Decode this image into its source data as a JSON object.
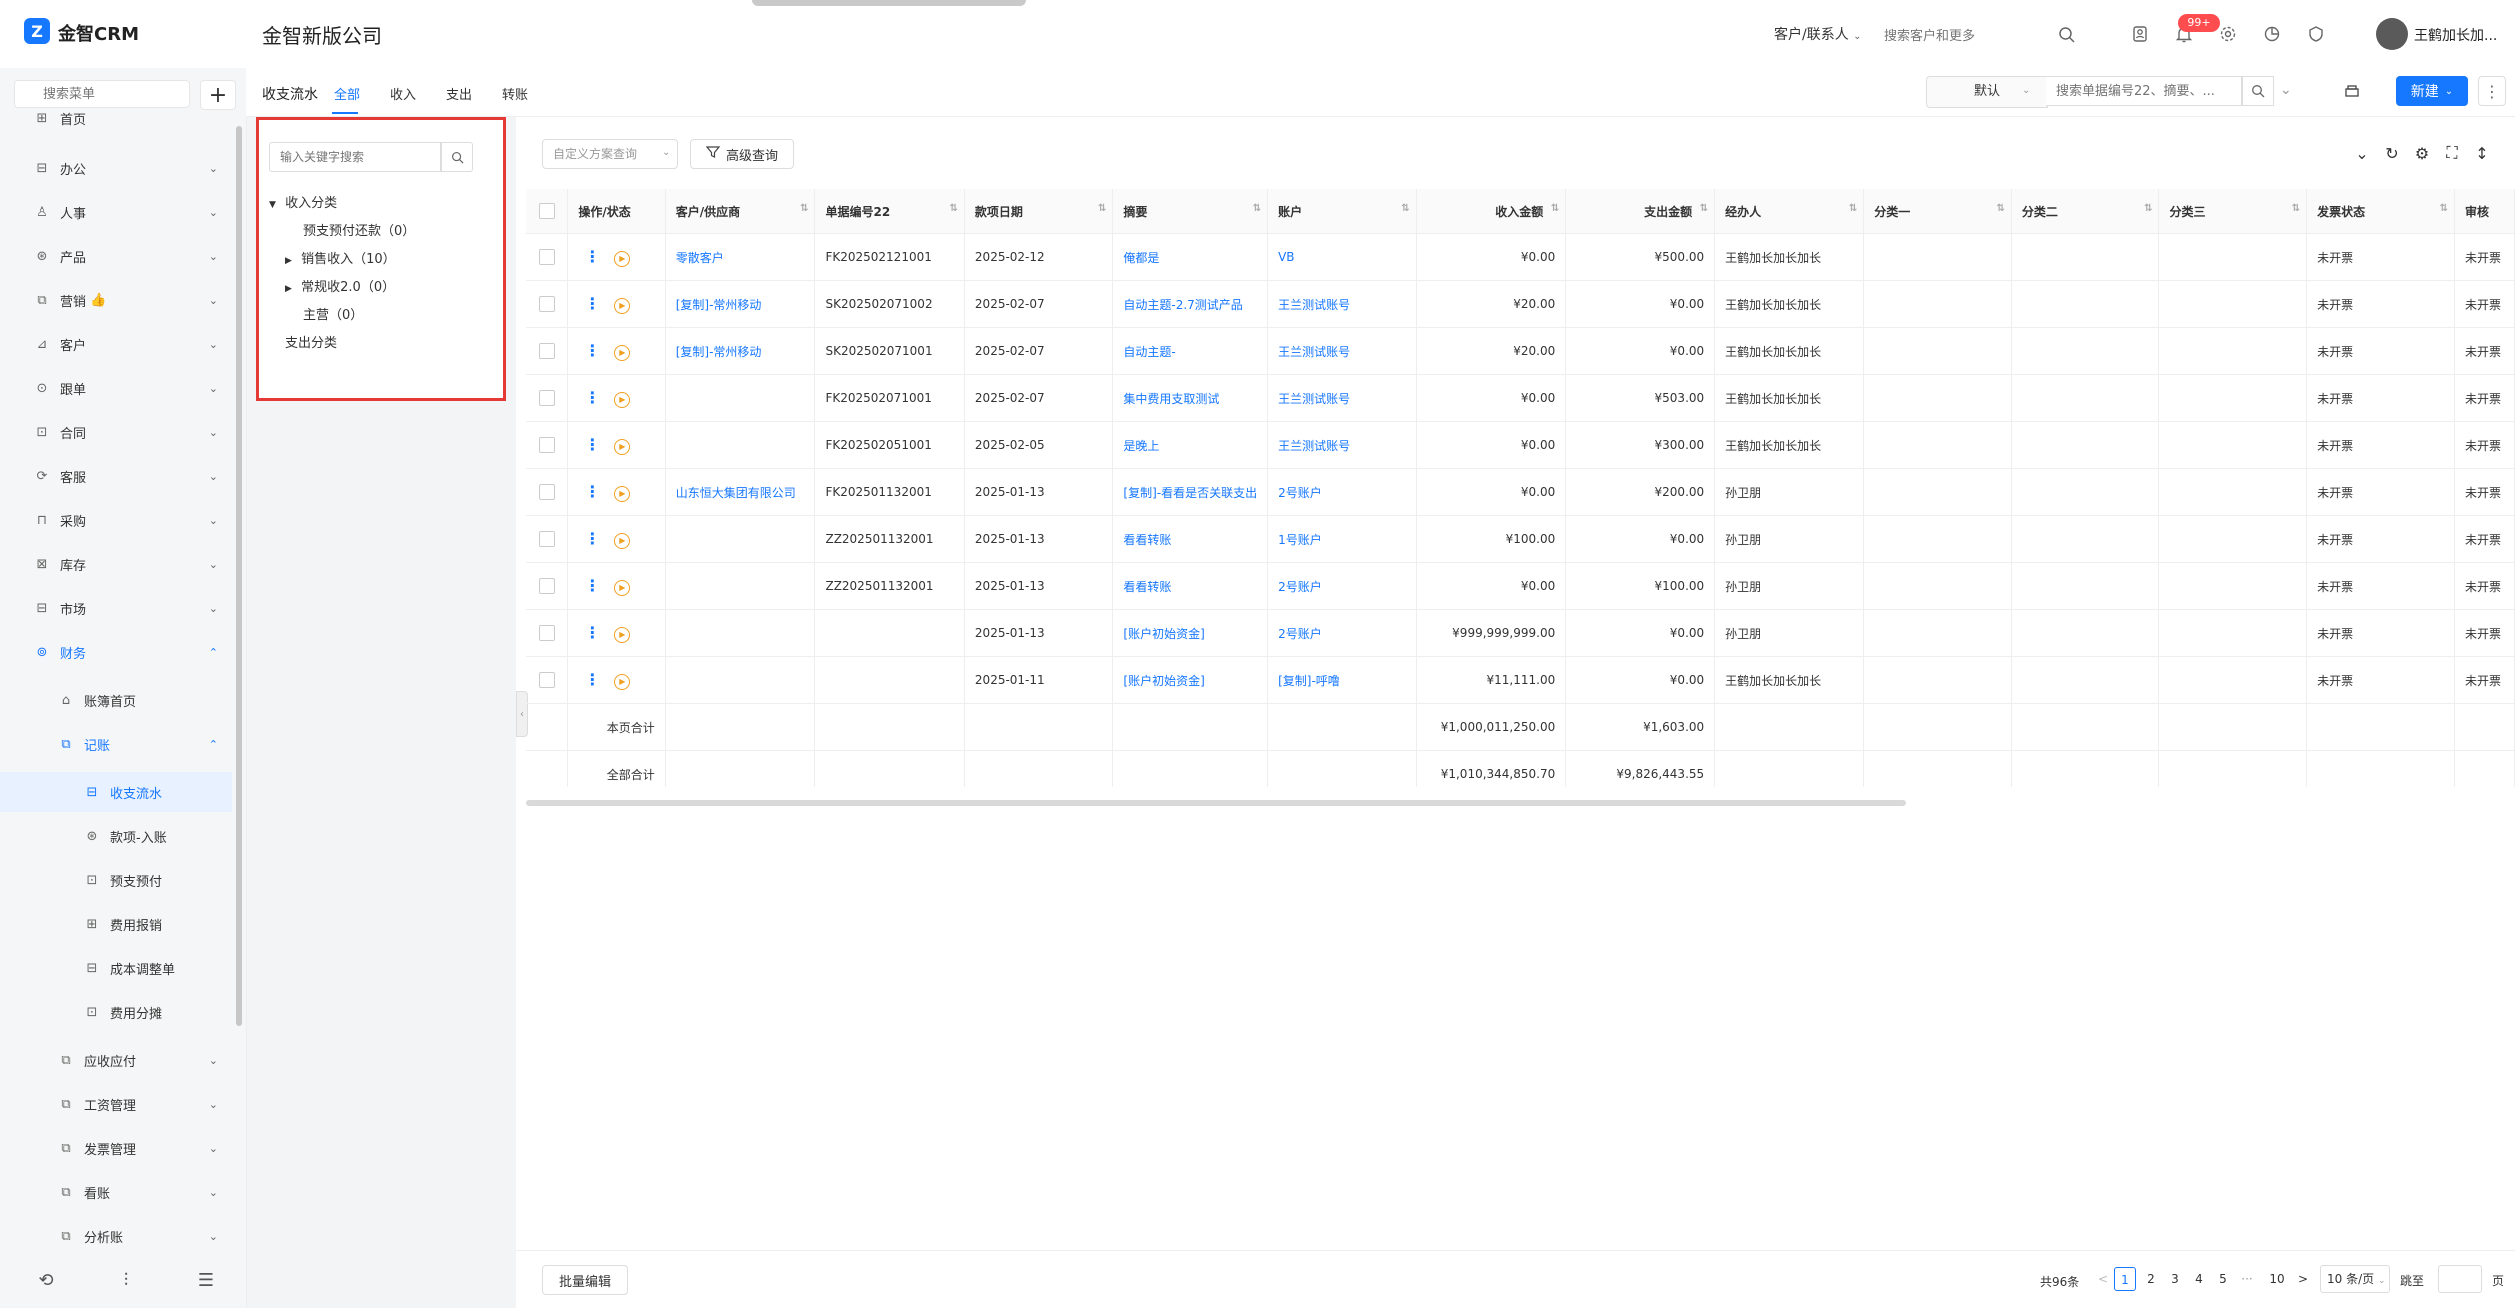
{
  "app": {
    "name": "金智CRM",
    "company": "金智新版公司",
    "logo_glyph": "Z"
  },
  "header": {
    "search_type": "客户/联系人",
    "search_placeholder": "搜索客户和更多",
    "notification_badge": "99+",
    "user_name": "王鹤加长加..."
  },
  "sidebar": {
    "search_placeholder": "搜索菜单",
    "items": [
      {
        "label": "首页"
      },
      {
        "label": "办公"
      },
      {
        "label": "人事"
      },
      {
        "label": "产品"
      },
      {
        "label": "营销"
      },
      {
        "label": "客户"
      },
      {
        "label": "跟单"
      },
      {
        "label": "合同"
      },
      {
        "label": "客服"
      },
      {
        "label": "采购"
      },
      {
        "label": "库存"
      },
      {
        "label": "市场"
      },
      {
        "label": "财务"
      },
      {
        "label": "账簿首页"
      },
      {
        "label": "记账"
      },
      {
        "label": "收支流水"
      },
      {
        "label": "款项-入账"
      },
      {
        "label": "预支预付"
      },
      {
        "label": "费用报销"
      },
      {
        "label": "成本调整单"
      },
      {
        "label": "费用分摊"
      },
      {
        "label": "应收应付"
      },
      {
        "label": "工资管理"
      },
      {
        "label": "发票管理"
      },
      {
        "label": "看账"
      },
      {
        "label": "分析账"
      }
    ],
    "marketing_emoji": "👍"
  },
  "page": {
    "title": "收支流水",
    "tabs": [
      "全部",
      "收入",
      "支出",
      "转账"
    ],
    "view_select": "默认",
    "doc_search_placeholder": "搜索单据编号22、摘要、...",
    "new_label": "新建"
  },
  "tree": {
    "search_placeholder": "输入关键字搜索",
    "nodes": [
      {
        "label": "收入分类"
      },
      {
        "label": "预支预付还款（0）"
      },
      {
        "label": "销售收入（10）"
      },
      {
        "label": "常规收2.0（0）"
      },
      {
        "label": "主营（0）"
      },
      {
        "label": "支出分类"
      }
    ]
  },
  "toolbar": {
    "filter_scheme_placeholder": "自定义方案查询",
    "advanced_query": "高级查询"
  },
  "table": {
    "columns": [
      "操作/状态",
      "客户/供应商",
      "单据编号22",
      "款项日期",
      "摘要",
      "账户",
      "收入金额",
      "支出金额",
      "经办人",
      "分类一",
      "分类二",
      "分类三",
      "发票状态",
      "审核"
    ],
    "rows": [
      {
        "customer": "零散客户",
        "doc_no": "FK202502121001",
        "date": "2025-02-12",
        "summary": "俺都是",
        "account": "VB",
        "income": "¥0.00",
        "expense": "¥500.00",
        "handler": "王鹤加长加长加长",
        "invoice": "未开票"
      },
      {
        "customer": "[复制]-常州移动",
        "doc_no": "SK202502071002",
        "date": "2025-02-07",
        "summary": "自动主题-2.7测试产品",
        "account": "王兰测试账号",
        "income": "¥20.00",
        "expense": "¥0.00",
        "handler": "王鹤加长加长加长",
        "invoice": "未开票"
      },
      {
        "customer": "[复制]-常州移动",
        "doc_no": "SK202502071001",
        "date": "2025-02-07",
        "summary": "自动主题-",
        "account": "王兰测试账号",
        "income": "¥20.00",
        "expense": "¥0.00",
        "handler": "王鹤加长加长加长",
        "invoice": "未开票"
      },
      {
        "customer": "",
        "doc_no": "FK202502071001",
        "date": "2025-02-07",
        "summary": "集中费用支取测试",
        "account": "王兰测试账号",
        "income": "¥0.00",
        "expense": "¥503.00",
        "handler": "王鹤加长加长加长",
        "invoice": "未开票"
      },
      {
        "customer": "",
        "doc_no": "FK202502051001",
        "date": "2025-02-05",
        "summary": "是晚上",
        "account": "王兰测试账号",
        "income": "¥0.00",
        "expense": "¥300.00",
        "handler": "王鹤加长加长加长",
        "invoice": "未开票"
      },
      {
        "customer": "山东恒大集团有限公司",
        "doc_no": "FK202501132001",
        "date": "2025-01-13",
        "summary": "[复制]-看看是否关联支出",
        "account": "2号账户",
        "income": "¥0.00",
        "expense": "¥200.00",
        "handler": "孙卫朋",
        "invoice": "未开票"
      },
      {
        "customer": "",
        "doc_no": "ZZ202501132001",
        "date": "2025-01-13",
        "summary": "看看转账",
        "account": "1号账户",
        "income": "¥100.00",
        "expense": "¥0.00",
        "handler": "孙卫朋",
        "invoice": "未开票"
      },
      {
        "customer": "",
        "doc_no": "ZZ202501132001",
        "date": "2025-01-13",
        "summary": "看看转账",
        "account": "2号账户",
        "income": "¥0.00",
        "expense": "¥100.00",
        "handler": "孙卫朋",
        "invoice": "未开票"
      },
      {
        "customer": "",
        "doc_no": "",
        "date": "2025-01-13",
        "summary": "[账户初始资金]",
        "account": "2号账户",
        "income": "¥999,999,999.00",
        "expense": "¥0.00",
        "handler": "孙卫朋",
        "invoice": "未开票"
      },
      {
        "customer": "",
        "doc_no": "",
        "date": "2025-01-11",
        "summary": "[账户初始资金]",
        "account": "[复制]-呼噜",
        "income": "¥11,111.00",
        "expense": "¥0.00",
        "handler": "王鹤加长加长加长",
        "invoice": "未开票"
      }
    ],
    "page_total_label": "本页合计",
    "page_total_income": "¥1,000,011,250.00",
    "page_total_expense": "¥1,603.00",
    "all_total_label": "全部合计",
    "all_total_income": "¥1,010,344,850.70",
    "all_total_expense": "¥9,826,443.55"
  },
  "footer": {
    "batch_edit": "批量编辑",
    "total": "共96条",
    "pages": [
      "1",
      "2",
      "3",
      "4",
      "5",
      "···",
      "10"
    ],
    "page_size": "10 条/页",
    "jump_label": "跳至",
    "jump_unit": "页"
  }
}
